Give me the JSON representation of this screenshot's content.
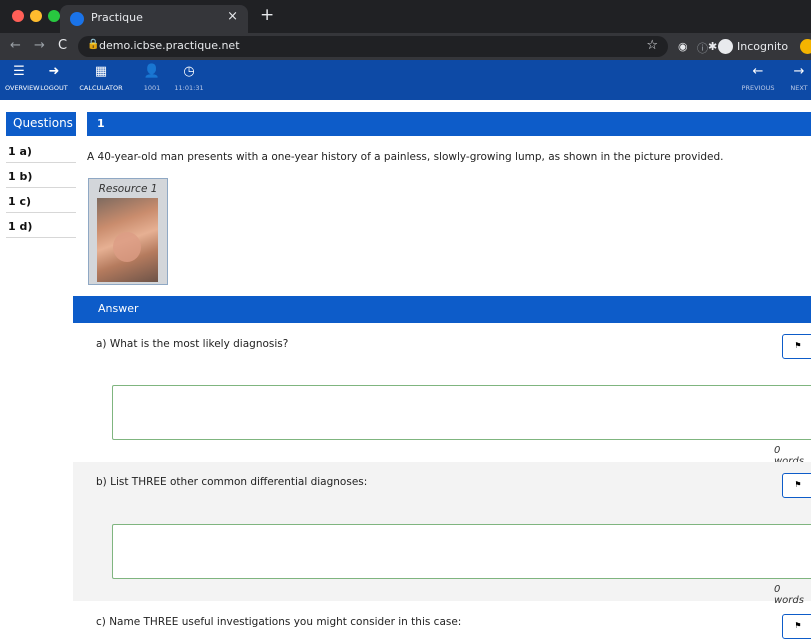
{
  "browser": {
    "tab_title": "Practique",
    "tab_close": "×",
    "new_tab": "+",
    "url": "demo.icbse.practique.net",
    "incognito_label": "Incognito",
    "colors": {
      "close": "#ff5f57",
      "minimize": "#febc2e",
      "maximize": "#28c840"
    }
  },
  "toolbar": {
    "overview": "OVERVIEW",
    "logout": "LOGOUT",
    "calculator": "CALCULATOR",
    "candidate": "1001",
    "timer": "11:01:31",
    "previous": "PREVIOUS",
    "next": "NEXT"
  },
  "sidebar": {
    "header": "Questions",
    "items": [
      "1 a)",
      "1 b)",
      "1 c)",
      "1 d)"
    ]
  },
  "question": {
    "number": "1",
    "stem": "A 40-year-old man presents with a one-year history of a painless, slowly-growing lump, as shown in the picture provided.",
    "resource_label": "Resource 1"
  },
  "answer": {
    "header": "Answer",
    "parts": [
      {
        "label": "a) What is the most likely diagnosis?",
        "value": "",
        "word_count": "0 words"
      },
      {
        "label": "b) List THREE other common differential diagnoses:",
        "value": "",
        "word_count": "0 words"
      },
      {
        "label": "c) Name THREE useful investigations you might consider in this case:"
      }
    ],
    "flag_icon": "flag-icon"
  }
}
